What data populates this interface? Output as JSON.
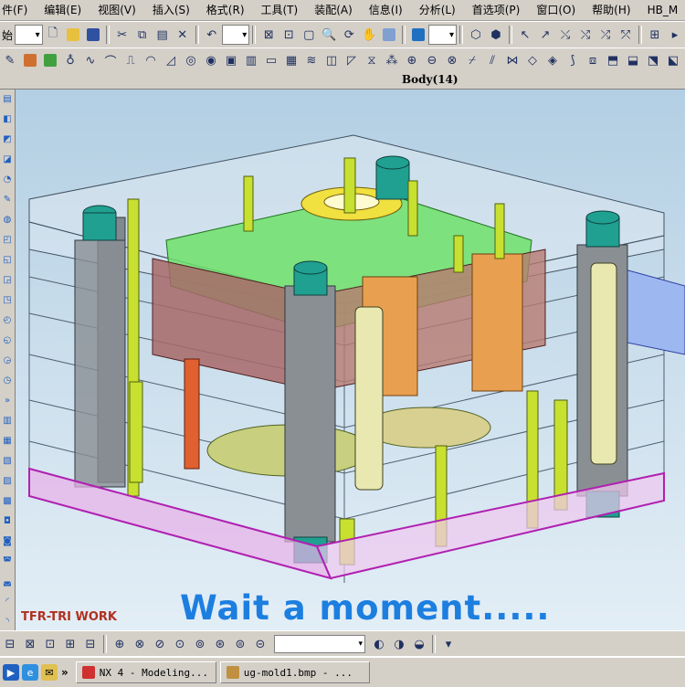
{
  "menu": {
    "items": [
      "件(F)",
      "编辑(E)",
      "视图(V)",
      "插入(S)",
      "格式(R)",
      "工具(T)",
      "装配(A)",
      "信息(I)",
      "分析(L)",
      "首选项(P)",
      "窗口(O)",
      "帮助(H)",
      "HB_M"
    ]
  },
  "toolbar": {
    "start_label": "始"
  },
  "window": {
    "title": "Body(14)"
  },
  "viewport": {
    "brand": "TFR-TRI WORK",
    "message": "Wait a moment....."
  },
  "taskbar": {
    "quick_launch": [
      "media-player-icon",
      "internet-explorer-icon",
      "outlook-express-icon"
    ],
    "tasks": [
      {
        "label": "NX 4 - Modeling...",
        "icon": "nx-app-icon"
      },
      {
        "label": "ug-mold1.bmp - ...",
        "icon": "image-file-icon"
      }
    ],
    "overflow_chevron": "»"
  },
  "colors": {
    "accent_message": "#1c7fe0",
    "brand_text": "#b03020",
    "ui_chrome": "#d4d0c8"
  }
}
